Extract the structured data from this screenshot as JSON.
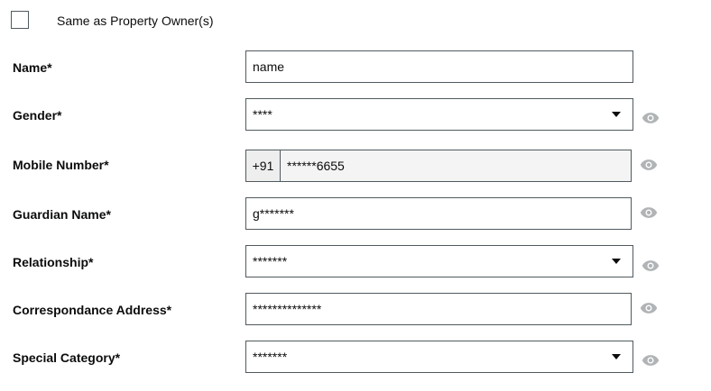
{
  "same_as_owner": {
    "label": "Same as Property Owner(s)",
    "checked": false
  },
  "fields": {
    "name": {
      "label": "Name*",
      "value": "name"
    },
    "gender": {
      "label": "Gender*",
      "value": "****"
    },
    "mobile": {
      "label": "Mobile Number*",
      "prefix": "+91",
      "value": "******6655"
    },
    "guardian": {
      "label": "Guardian Name*",
      "value": "g*******"
    },
    "relationship": {
      "label": "Relationship*",
      "value": "*******"
    },
    "address": {
      "label": "Correspondance Address*",
      "value": "**************"
    },
    "special": {
      "label": "Special Category*",
      "value": "*******"
    }
  },
  "icons": {
    "eye": "eye-icon",
    "dropdown": "chevron-down-icon"
  },
  "colors": {
    "border": "#505a5f",
    "eye": "#b1b4b6",
    "readonly_bg": "#f4f4f4"
  }
}
